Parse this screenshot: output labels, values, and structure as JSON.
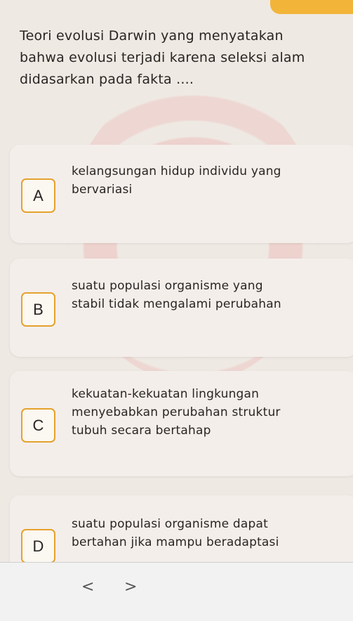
{
  "question": {
    "lines": [
      "Teori evolusi Darwin yang menyatakan",
      "bahwa evolusi terjadi karena seleksi alam",
      "didasarkan pada fakta ...."
    ]
  },
  "options": [
    {
      "letter": "A",
      "lines": [
        "kelangsungan hidup individu yang",
        "bervariasi"
      ]
    },
    {
      "letter": "B",
      "lines": [
        "suatu populasi organisme yang",
        "stabil tidak mengalami perubahan"
      ]
    },
    {
      "letter": "C",
      "lines": [
        "kekuatan-kekuatan lingkungan",
        "menyebabkan perubahan struktur",
        "tubuh secara bertahap"
      ]
    },
    {
      "letter": "D",
      "lines": [
        "suatu populasi organisme dapat",
        "bertahan jika mampu beradaptasi"
      ]
    }
  ],
  "navigation": {
    "prev_icon": "<",
    "next_icon": ">"
  },
  "colors": {
    "accent": "#e5a22c",
    "top_accent": "#f2b53a",
    "card": "#f4eeea"
  }
}
